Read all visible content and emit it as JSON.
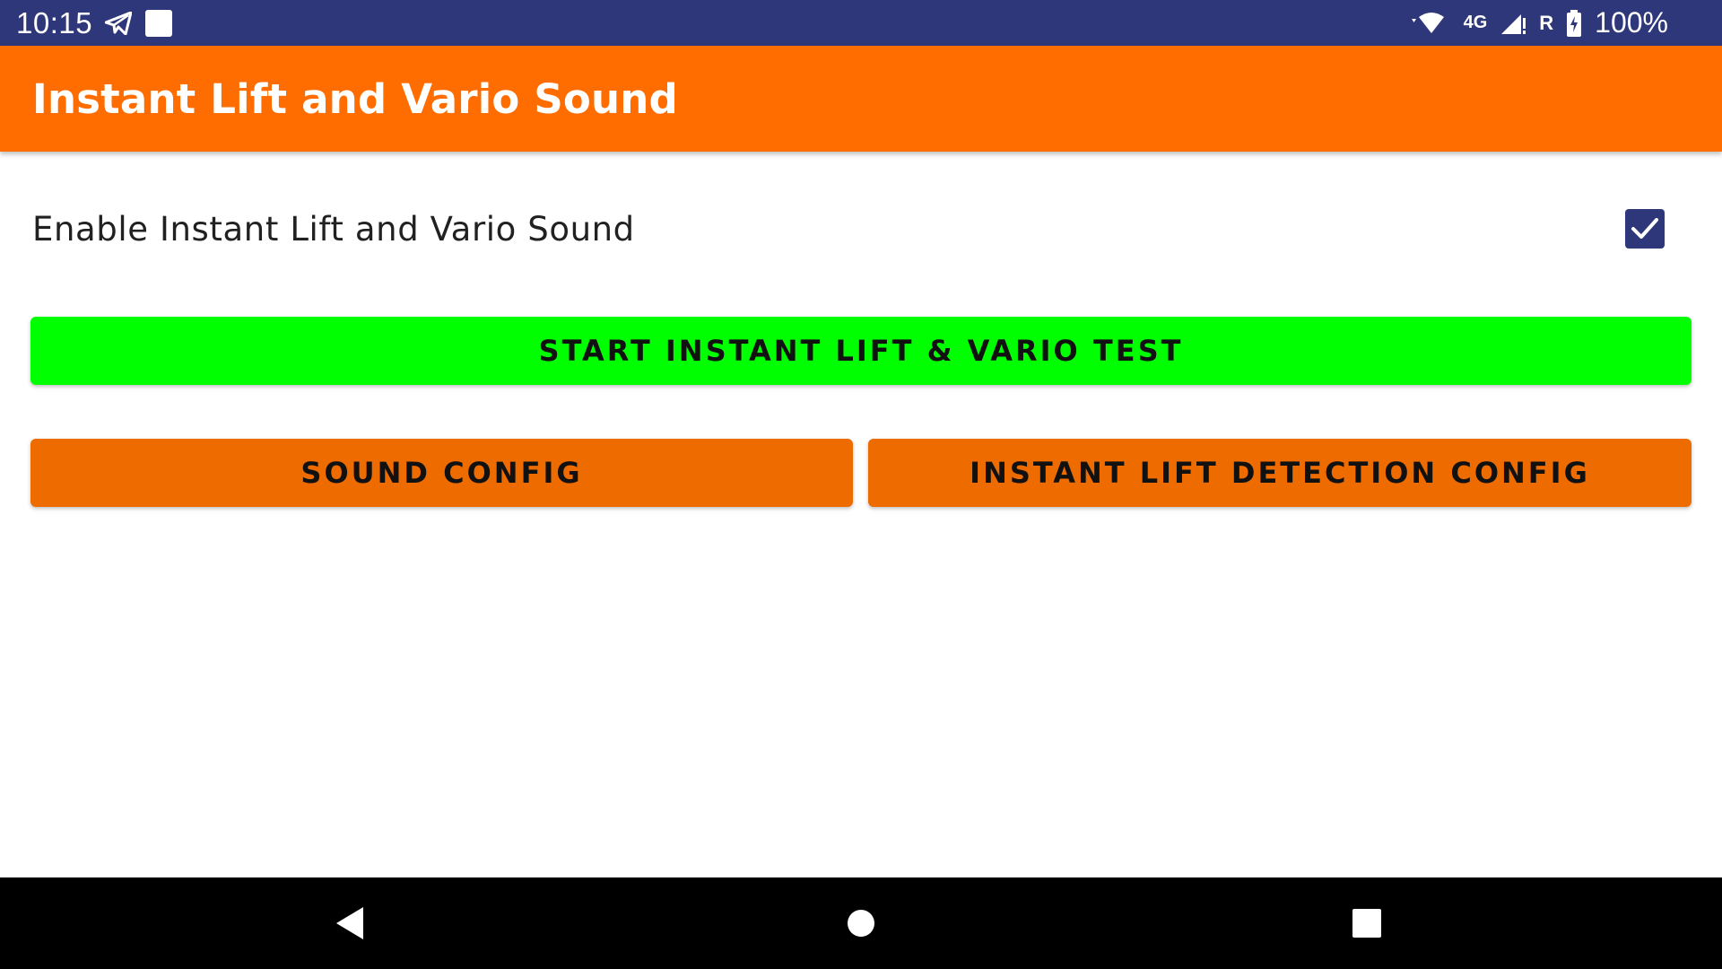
{
  "status_bar": {
    "time": "10:15",
    "battery_percent": "100%",
    "network": "4G",
    "roaming": "R",
    "icons": [
      "telegram-icon",
      "notification-square-icon",
      "wifi-icon",
      "signal-icon",
      "battery-charging-icon"
    ]
  },
  "app_bar": {
    "title": "Instant Lift and Vario Sound",
    "color": "#ff6d00"
  },
  "settings": {
    "enable_label": "Enable Instant Lift and Vario Sound",
    "enable_checked": true,
    "checkbox_color": "#2e3779"
  },
  "buttons": {
    "start_test": "START INSTANT LIFT & VARIO TEST",
    "sound_config": "SOUND CONFIG",
    "detection_config": "INSTANT LIFT DETECTION CONFIG"
  },
  "colors": {
    "status_bar": "#2e3779",
    "start_button": "#00ff00",
    "config_button": "#ee6b00"
  },
  "nav_bar": {
    "icons": [
      "back-icon",
      "home-icon",
      "recents-icon"
    ]
  }
}
